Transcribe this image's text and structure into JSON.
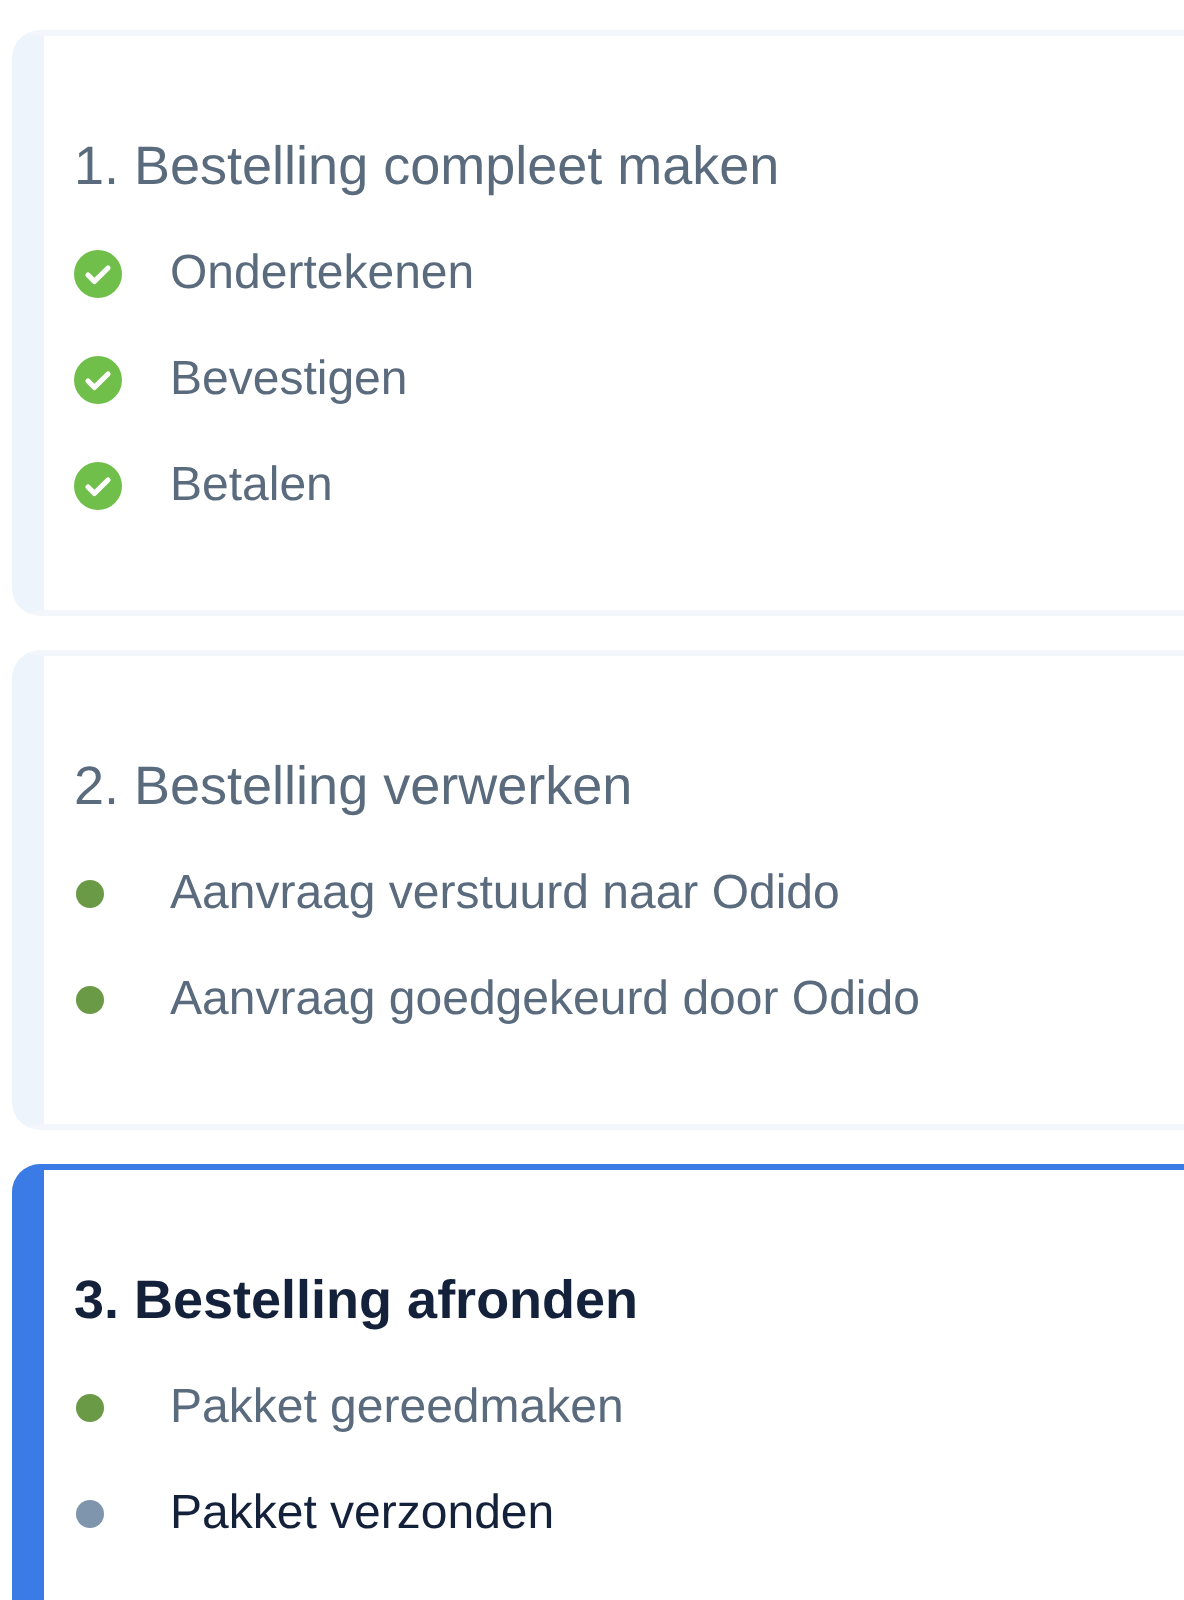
{
  "sections": [
    {
      "title": "1. Bestelling compleet maken",
      "active": false,
      "steps": [
        {
          "label": "Ondertekenen",
          "kind": "check",
          "done": true,
          "color": "#6fbf4a"
        },
        {
          "label": "Bevestigen",
          "kind": "check",
          "done": true,
          "color": "#6fbf4a"
        },
        {
          "label": "Betalen",
          "kind": "check",
          "done": true,
          "color": "#6fbf4a"
        }
      ]
    },
    {
      "title": "2. Bestelling verwerken",
      "active": false,
      "steps": [
        {
          "label": "Aanvraag verstuurd naar Odido",
          "kind": "dot",
          "done": true,
          "color": "#6a9a45"
        },
        {
          "label": "Aanvraag goedgekeurd door Odido",
          "kind": "dot",
          "done": true,
          "color": "#6a9a45"
        }
      ]
    },
    {
      "title": "3. Bestelling afronden",
      "active": true,
      "steps": [
        {
          "label": "Pakket gereedmaken",
          "kind": "dot",
          "done": true,
          "color": "#6a9a45"
        },
        {
          "label": "Pakket verzonden",
          "kind": "dot",
          "done": false,
          "color": "#7f95ad"
        }
      ]
    }
  ]
}
